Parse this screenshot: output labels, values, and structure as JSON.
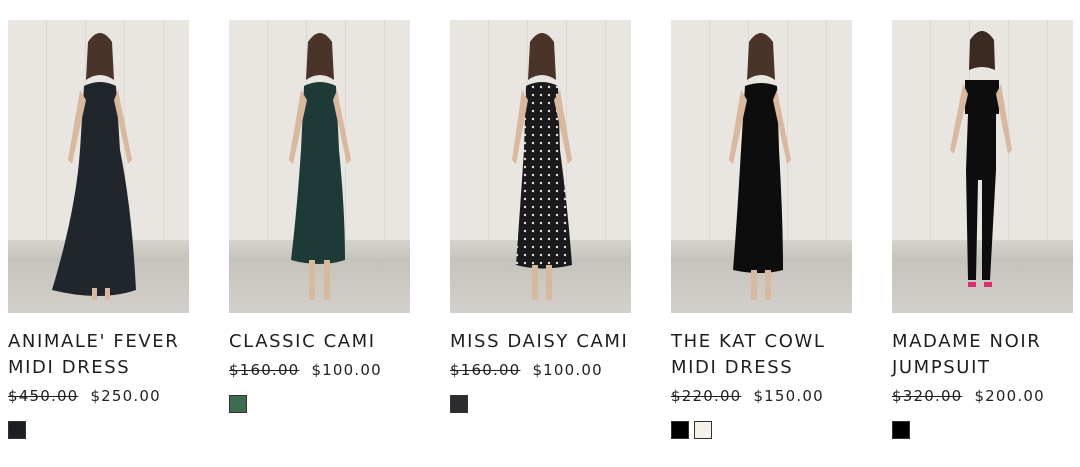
{
  "products": [
    {
      "name": "ANIMALE' FEVER MIDI DRESS",
      "old_price": "$450.00",
      "price": "$250.00",
      "swatches": [
        "#1b1f23"
      ]
    },
    {
      "name": "CLASSIC CAMI",
      "old_price": "$160.00",
      "price": "$100.00",
      "swatches": [
        "#3f6b4e"
      ]
    },
    {
      "name": "MISS DAISY CAMI",
      "old_price": "$160.00",
      "price": "$100.00",
      "swatches": [
        "#2a2c30"
      ]
    },
    {
      "name": "THE KAT COWL MIDI DRESS",
      "old_price": "$220.00",
      "price": "$150.00",
      "swatches": [
        "#000000",
        "#f6f1e6"
      ]
    },
    {
      "name": "MADAME NOIR JUMPSUIT",
      "old_price": "$320.00",
      "price": "$200.00",
      "swatches": [
        "#000000"
      ]
    }
  ]
}
